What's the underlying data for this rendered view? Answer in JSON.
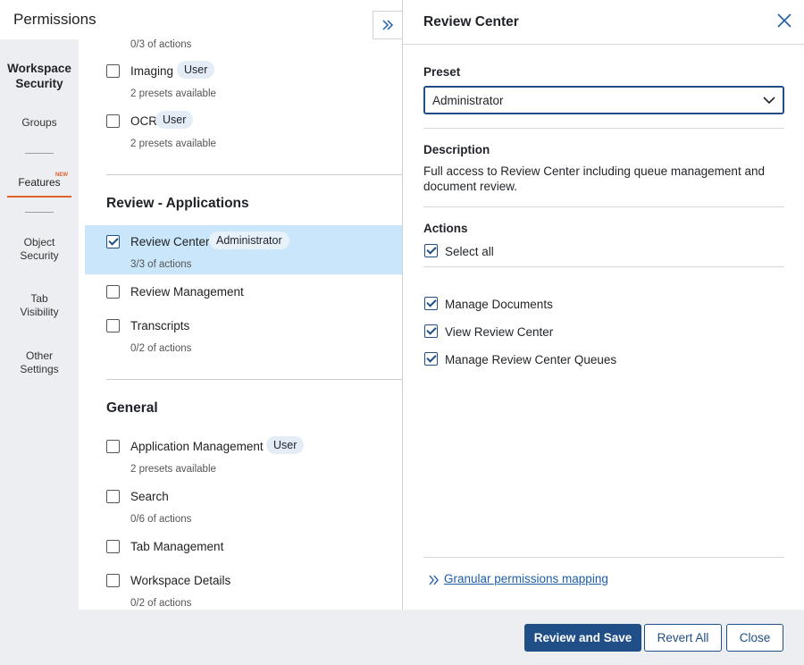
{
  "header": {
    "title": "Permissions"
  },
  "nav": {
    "title_line1": "Workspace",
    "title_line2": "Security",
    "groups": "Groups",
    "features": "Features",
    "new_badge": "NEW",
    "object_line1": "Object",
    "object_line2": "Security",
    "tab_line1": "Tab",
    "tab_line2": "Visibility",
    "other_line1": "Other",
    "other_line2": "Settings"
  },
  "list": {
    "top_sub": "0/3 of actions",
    "imaging": {
      "label": "Imaging",
      "pill": "User",
      "sub": "2 presets available",
      "checked": false
    },
    "ocr": {
      "label": "OCR",
      "pill": "User",
      "sub": "2 presets available",
      "checked": false
    },
    "section_review": "Review - Applications",
    "review_center": {
      "label": "Review Center",
      "pill": "Administrator",
      "sub": "3/3 of actions",
      "checked": true
    },
    "review_management": {
      "label": "Review Management",
      "checked": false
    },
    "transcripts": {
      "label": "Transcripts",
      "sub": "0/2 of actions",
      "checked": false
    },
    "section_general": "General",
    "app_management": {
      "label": "Application Management",
      "pill": "User",
      "sub": "2 presets available",
      "checked": false
    },
    "search": {
      "label": "Search",
      "sub": "0/6 of actions",
      "checked": false
    },
    "tab_management": {
      "label": "Tab Management",
      "checked": false
    },
    "workspace_details": {
      "label": "Workspace Details",
      "sub": "0/2 of actions",
      "checked": false
    }
  },
  "panel": {
    "title": "Review Center",
    "preset_label": "Preset",
    "preset_value": "Administrator",
    "description_label": "Description",
    "description_text": "Full access to Review Center including queue management and document review.",
    "actions_label": "Actions",
    "select_all": "Select all",
    "actions": [
      {
        "label": "Manage Documents",
        "checked": true
      },
      {
        "label": "View Review Center",
        "checked": true
      },
      {
        "label": "Manage Review Center Queues",
        "checked": true
      }
    ],
    "mapping_link": "Granular permissions mapping"
  },
  "footer": {
    "review_save": "Review and Save",
    "revert_all": "Revert All",
    "close": "Close"
  },
  "colors": {
    "accent": "#1f4f86",
    "selected_row": "#c9e6fb",
    "nav_active": "#e0622a",
    "nav_bg": "#eceef1"
  },
  "icons": {
    "expand": "double-chevron-right-icon",
    "close": "close-x-icon",
    "dropdown": "chevron-down-icon",
    "link": "double-chevron-right-icon"
  }
}
